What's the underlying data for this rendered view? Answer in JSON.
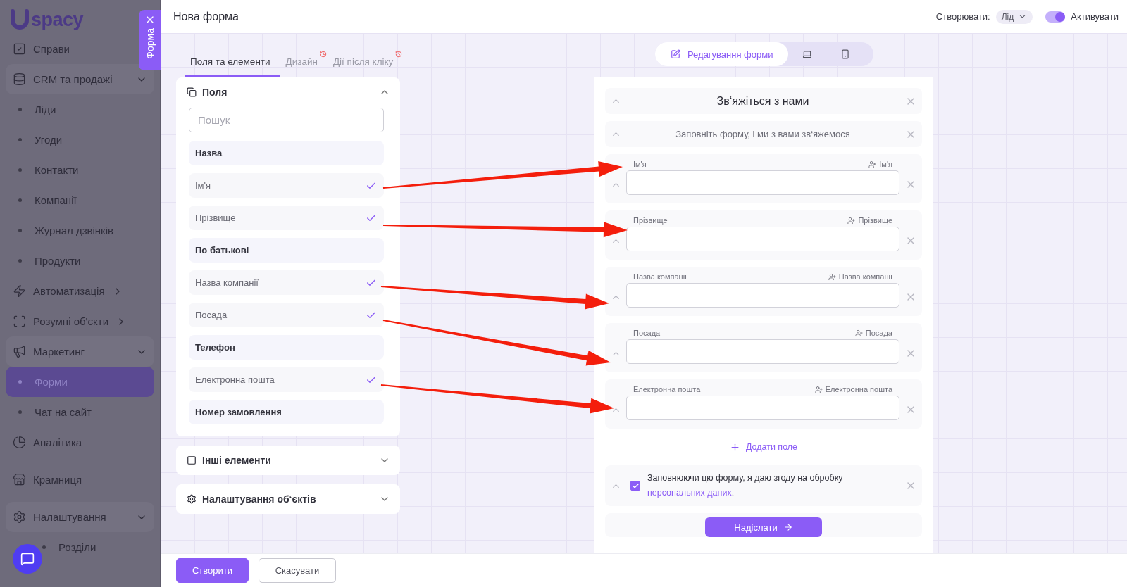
{
  "sidebar": {
    "logo": "spacy",
    "panel_tab": "Форма",
    "items": [
      {
        "label": "Справи",
        "kind": "link",
        "selected": false
      },
      {
        "label": "CRM та продажі",
        "kind": "group",
        "expanded": true,
        "selected": false,
        "children": [
          {
            "label": "Ліди",
            "selected": false
          },
          {
            "label": "Угоди",
            "selected": false
          },
          {
            "label": "Контакти",
            "selected": false
          },
          {
            "label": "Компанії",
            "selected": false
          },
          {
            "label": "Журнал дзвінків",
            "selected": false
          },
          {
            "label": "Продукти",
            "selected": false
          }
        ]
      },
      {
        "label": "Автоматизація",
        "kind": "group",
        "expanded": false,
        "selected": false
      },
      {
        "label": "Розумні об'єкти",
        "kind": "group",
        "expanded": false,
        "selected": false
      },
      {
        "label": "Маркетинг",
        "kind": "group",
        "expanded": true,
        "selected": false,
        "children": [
          {
            "label": "Форми",
            "selected": true
          },
          {
            "label": "Чат на сайт",
            "selected": false
          }
        ]
      },
      {
        "label": "Аналітика",
        "kind": "link",
        "selected": false
      },
      {
        "label": "Крамниця",
        "kind": "link",
        "selected": false
      },
      {
        "label": "Налаштування",
        "kind": "group",
        "expanded": true,
        "selected": false,
        "children": [
          {
            "label": "Розділи",
            "selected": false
          }
        ]
      }
    ]
  },
  "header": {
    "title": "Нова форма",
    "create_label": "Створювати:",
    "create_value": "Лід",
    "activate": {
      "label": "Активувати",
      "on": true
    }
  },
  "left_tabs": [
    {
      "label": "Поля та елементи",
      "selected": true,
      "alert": false
    },
    {
      "label": "Дизайн",
      "selected": false,
      "alert": true
    },
    {
      "label": "Дії після кліку",
      "selected": false,
      "alert": true
    }
  ],
  "fields_section": {
    "title": "Поля",
    "expanded": true,
    "search_placeholder": "Пошук",
    "items": [
      {
        "label": "Назва",
        "checked": false
      },
      {
        "label": "Ім'я",
        "checked": true
      },
      {
        "label": "Прізвище",
        "checked": true
      },
      {
        "label": "По батькові",
        "checked": false
      },
      {
        "label": "Назва компанії",
        "checked": true
      },
      {
        "label": "Посада",
        "checked": true
      },
      {
        "label": "Телефон",
        "checked": false
      },
      {
        "label": "Електронна пошта",
        "checked": true
      },
      {
        "label": "Номер замовлення",
        "checked": false
      }
    ]
  },
  "other_sections": [
    {
      "title": "Інші елементи",
      "expanded": false
    },
    {
      "title": "Налаштування об‘єктів",
      "expanded": false
    }
  ],
  "view_modes": [
    {
      "kind": "edit",
      "label": "Редагування форми",
      "selected": true
    },
    {
      "kind": "desktop",
      "selected": false
    },
    {
      "kind": "mobile",
      "selected": false
    }
  ],
  "form": {
    "title": "Зв‘яжіться з нами",
    "subtitle": "Заповніть форму, і ми з вами зв‘яжемося",
    "fields": [
      {
        "label": "Ім'я",
        "mapping": "Ім'я"
      },
      {
        "label": "Прізвище",
        "mapping": "Прізвище"
      },
      {
        "label": "Назва компанії",
        "mapping": "Назва компанії"
      },
      {
        "label": "Посада",
        "mapping": "Посада"
      },
      {
        "label": "Електронна пошта",
        "mapping": "Електронна пошта"
      }
    ],
    "add_field": "Додати поле",
    "consent": {
      "checked": true,
      "text": "Заповнюючи цю форму, я даю згоду на обробку",
      "link": "персональних даних",
      "end": "."
    },
    "submit": "Надіслати"
  },
  "footer": {
    "buttons": [
      {
        "label": "Створити",
        "kind": "primary"
      },
      {
        "label": "Скасувати",
        "kind": "secondary"
      }
    ]
  }
}
